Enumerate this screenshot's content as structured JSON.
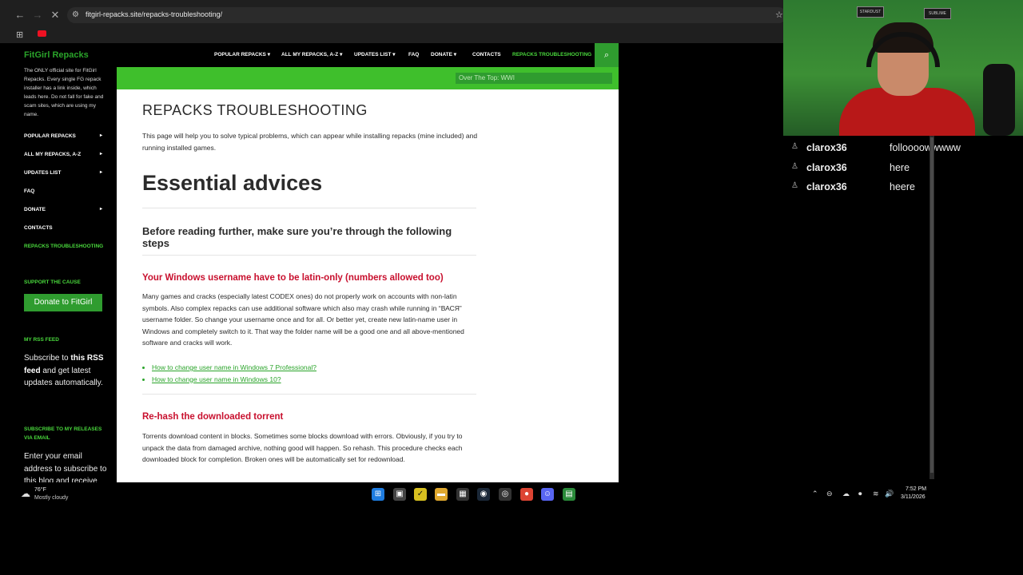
{
  "browser": {
    "url": "fitgirl-repacks.site/repacks-troubleshooting/",
    "icons": [
      "back-icon",
      "forward-icon",
      "reload-icon",
      "star-icon",
      "apps-icon",
      "youtube-icon"
    ]
  },
  "sidebar": {
    "logo": "FitGirl Repacks",
    "description": "The ONLY official site for FitGirl Repacks. Every single FG repack installer has a link inside, which leads here. Do not fall for fake and scam sites, which are using my name.",
    "menu": [
      {
        "label": "POPULAR REPACKS",
        "arrow": "▸"
      },
      {
        "label": "ALL MY REPACKS, A-Z",
        "arrow": "▸"
      },
      {
        "label": "UPDATES LIST",
        "arrow": "▸"
      },
      {
        "label": "FAQ",
        "arrow": ""
      },
      {
        "label": "DONATE",
        "arrow": "▸"
      },
      {
        "label": "CONTACTS",
        "arrow": ""
      },
      {
        "label": "REPACKS TROUBLESHOOTING",
        "arrow": ""
      }
    ],
    "support_title": "SUPPORT THE CAUSE",
    "donate_button": "Donate to FitGirl",
    "rss_title": "MY RSS FEED",
    "rss_prefix": "Subscribe to ",
    "rss_link": "this RSS feed",
    "rss_suffix": " and get latest updates automatically.",
    "email_title": "SUBSCRIBE TO MY RELEASES VIA EMAIL",
    "email_text": "Enter your email address to subscribe to this blog and receive"
  },
  "topnav": {
    "items": [
      {
        "label": "POPULAR REPACKS ▾"
      },
      {
        "label": "ALL MY REPACKS, A-Z ▾"
      },
      {
        "label": "UPDATES LIST ▾"
      },
      {
        "label": "FAQ"
      },
      {
        "label": "DONATE ▾"
      },
      {
        "label": "CONTACTS"
      },
      {
        "label": "REPACKS TROUBLESHOOTING"
      }
    ],
    "search_value": "Over The Top: WWI"
  },
  "content": {
    "page_title": "REPACKS TROUBLESHOOTING",
    "intro": "This page will help you to solve typical problems, which can appear while installing repacks (mine included) and running installed games.",
    "h1": "Essential advices",
    "h2": "Before reading further, make sure you’re through the following steps",
    "section1_title": "Your Windows username have to be latin-only (numbers allowed too)",
    "section1_text": "Many games and cracks (especially latest CODEX ones) do not properly work on accounts with non-latin symbols. Also complex repacks can use additional software which also may crash while running in “ВАСЯ” username folder. So change your username once and for all. Or better yet, create new latin-name user in Windows and completely switch to it. That way the folder name will be a good one and all above-mentioned software and cracks will work.",
    "links": [
      "How to change user name in Windows 7 Professional?",
      "How to change user name in Windows 10?"
    ],
    "section2_title": "Re-hash the downloaded torrent",
    "section2_text": "Torrents download content in blocks. Sometimes some blocks download with errors. Obviously, if you try to unpack the data from damaged archive, nothing good will happen. So rehash. This procedure checks each downloaded block for completion. Broken ones will be automatically set for redownload."
  },
  "webcam": {
    "posters": [
      "STARDUST",
      "SUBLIME"
    ]
  },
  "chat": [
    {
      "user": "clarox36",
      "message": "folloooowwwww"
    },
    {
      "user": "clarox36",
      "message": "here"
    },
    {
      "user": "clarox36",
      "message": "heere"
    }
  ],
  "taskbar": {
    "weather_temp": "76°F",
    "weather_desc": "Mostly cloudy",
    "time": "7:52 PM",
    "date": "3/11/2026"
  }
}
